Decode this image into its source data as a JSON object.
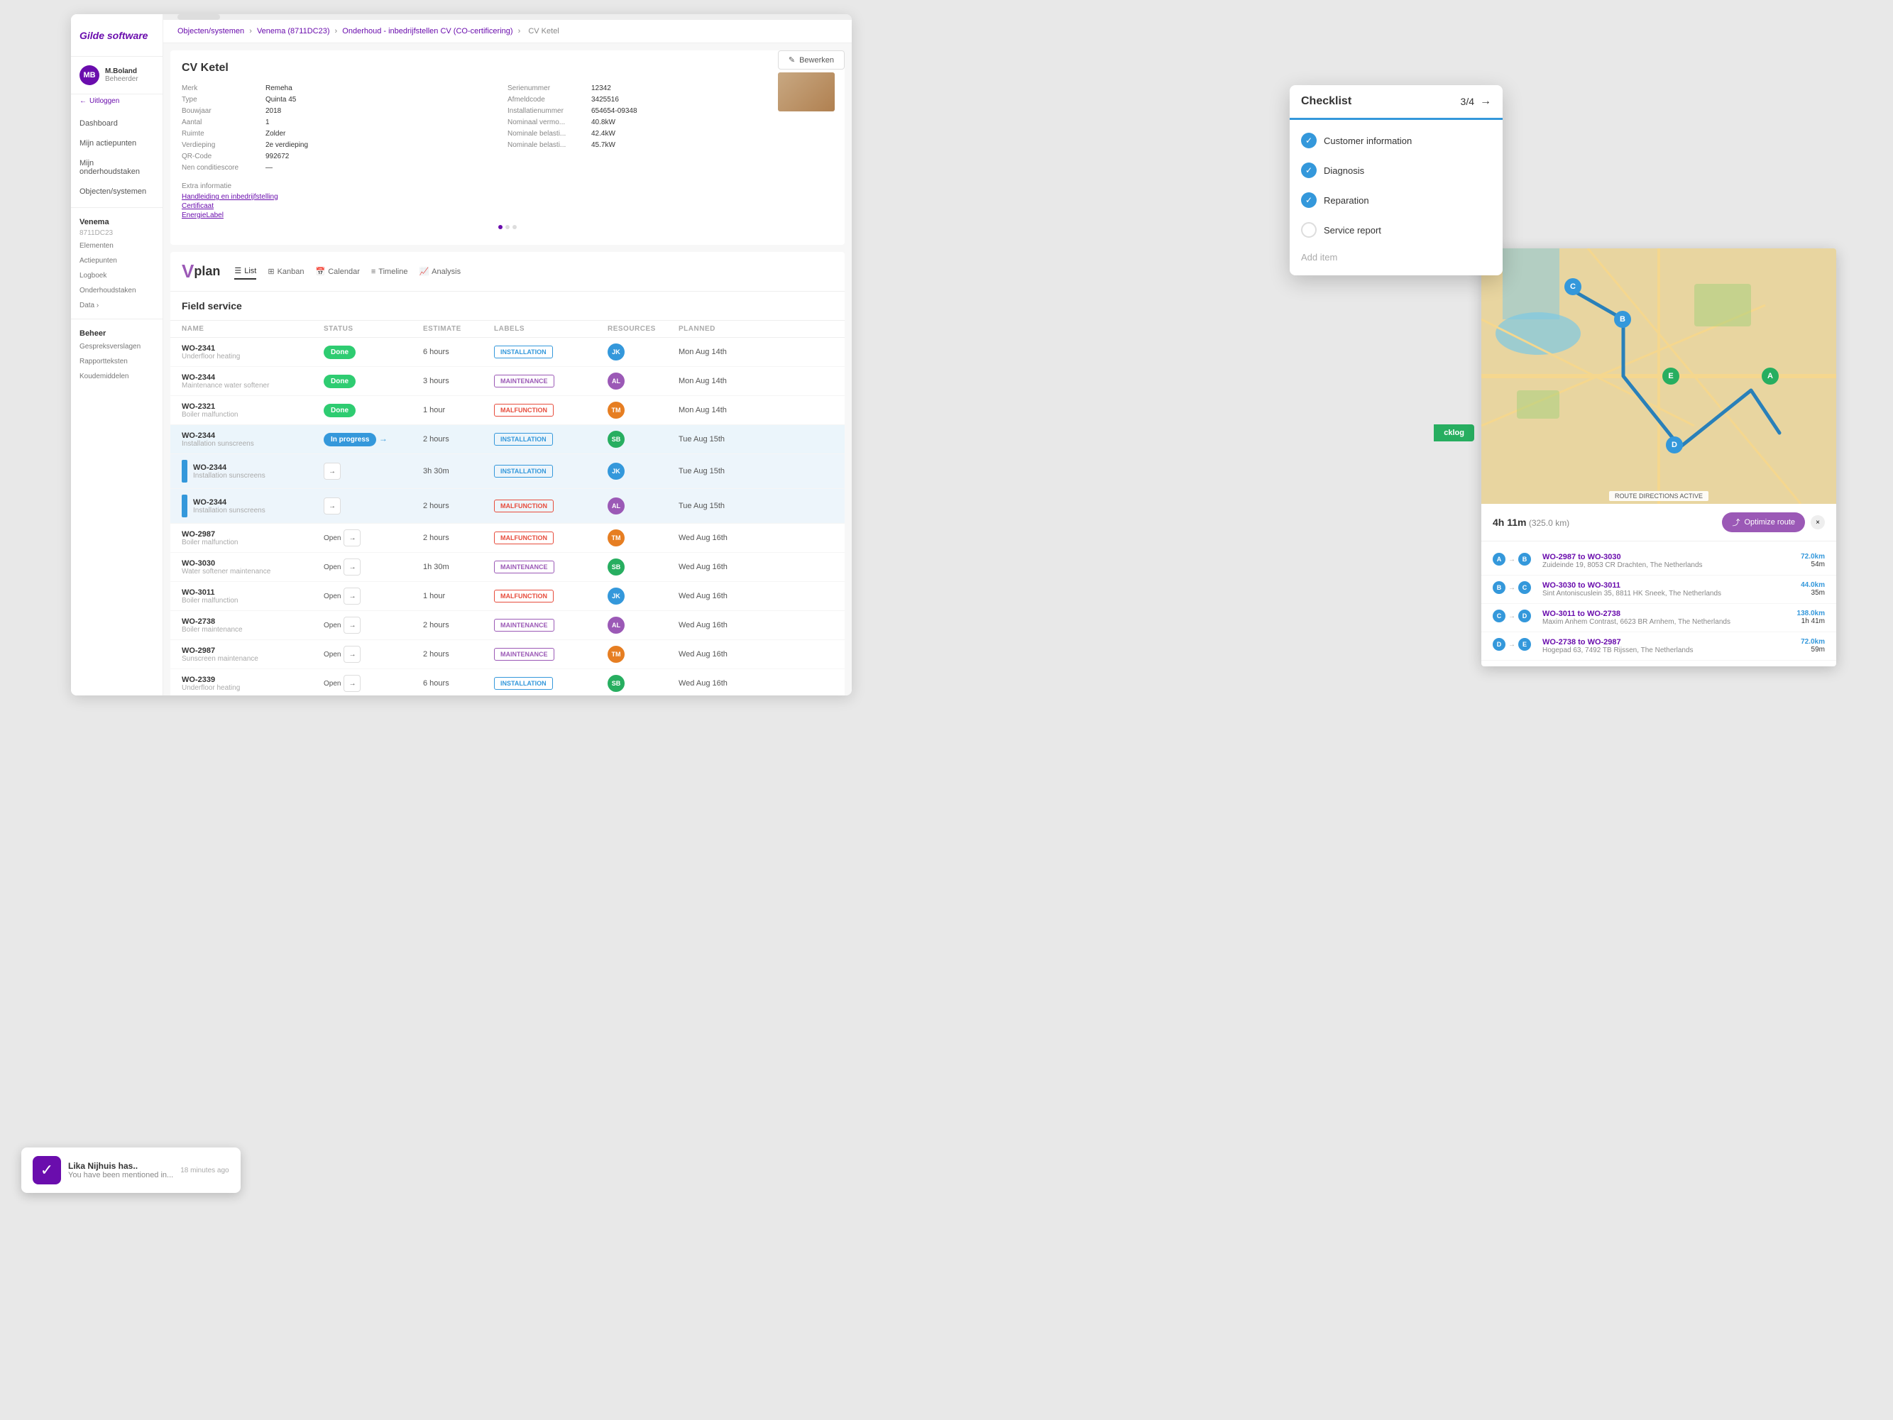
{
  "app": {
    "title": "Gilde software"
  },
  "sidebar": {
    "logo": "Gilde",
    "logo_sub": "software",
    "user": {
      "initials": "MB",
      "name": "M.Boland",
      "role": "Beheerder"
    },
    "logout_label": "Uitloggen",
    "nav_items": [
      {
        "label": "Dashboard",
        "active": false
      },
      {
        "label": "Mijn actiepunten",
        "active": false
      },
      {
        "label": "Mijn onderhoudstaken",
        "active": false
      },
      {
        "label": "Objecten/systemen",
        "active": false
      }
    ],
    "group_label": "Venema",
    "group_sub": "8711DC23",
    "group_items": [
      {
        "label": "Elementen"
      },
      {
        "label": "Actiepunten"
      },
      {
        "label": "Logboek"
      },
      {
        "label": "Onderhoudstaken"
      },
      {
        "label": "Data",
        "has_arrow": true
      }
    ],
    "beheer_label": "Beheer",
    "beheer_items": [
      {
        "label": "Gespreksverslagen"
      },
      {
        "label": "Rapportteksten"
      },
      {
        "label": "Koudemiddelen"
      }
    ]
  },
  "breadcrumb": {
    "items": [
      "Objecten/systemen",
      "Venema (8711DC23)",
      "Onderhoud - inbedrijfstellen CV (CO-certificering)",
      "CV Ketel"
    ],
    "separators": [
      ">",
      ">",
      ">"
    ]
  },
  "detail": {
    "title": "CV Ketel",
    "bewerken_label": "Bewerken",
    "fields_left": [
      {
        "label": "Merk",
        "value": "Remeha"
      },
      {
        "label": "Type",
        "value": "Quinta 45"
      },
      {
        "label": "Bouwjaar",
        "value": "2018"
      },
      {
        "label": "Aantal",
        "value": "1"
      },
      {
        "label": "Ruimte",
        "value": "Zolder"
      },
      {
        "label": "Verdieping",
        "value": "2e verdieping"
      },
      {
        "label": "QR-Code",
        "value": "992672"
      },
      {
        "label": "Nen conditiescore",
        "value": "—"
      }
    ],
    "fields_right": [
      {
        "label": "Serienummer",
        "value": "12342"
      },
      {
        "label": "Afmeldcode",
        "value": "3425516"
      },
      {
        "label": "Installatienummer",
        "value": "654654-09348"
      },
      {
        "label": "Nominaal vermo...",
        "value": "40.8kW"
      },
      {
        "label": "Nominale belasti...",
        "value": "42.4kW"
      },
      {
        "label": "Nominale belasti...",
        "value": "45.7kW"
      }
    ],
    "extra_info": "Extra informatie",
    "links": [
      "Handleiding en inbedrijfstelling",
      "Certificaat",
      "EnergieLabel"
    ],
    "dots": 3
  },
  "vplan": {
    "logo": "Vplan",
    "nav": [
      {
        "label": "List",
        "icon": "list",
        "active": true
      },
      {
        "label": "Kanban",
        "icon": "kanban",
        "active": false
      },
      {
        "label": "Calendar",
        "icon": "calendar",
        "active": false
      },
      {
        "label": "Timeline",
        "icon": "timeline",
        "active": false
      },
      {
        "label": "Analysis",
        "icon": "analysis",
        "active": false
      }
    ],
    "section_title": "Field service",
    "table_headers": [
      "NAME",
      "STATUS",
      "ESTIMATE",
      "LABELS",
      "RESOURCES",
      "PLANNED"
    ],
    "rows": [
      {
        "id": "WO-2341",
        "sub": "Underfloor heating",
        "status": "Done",
        "status_type": "done",
        "estimate": "6 hours",
        "label": "INSTALLATION",
        "label_type": "installation",
        "resource_color": "blue",
        "resource_initials": "JK",
        "planned": "Mon Aug 14th"
      },
      {
        "id": "WO-2344",
        "sub": "Maintenance water softener",
        "status": "Done",
        "status_type": "done",
        "estimate": "3 hours",
        "label": "MAINTENANCE",
        "label_type": "maintenance",
        "resource_color": "purple",
        "resource_initials": "AL",
        "planned": "Mon Aug 14th"
      },
      {
        "id": "WO-2321",
        "sub": "Boiler malfunction",
        "status": "Done",
        "status_type": "done",
        "estimate": "1 hour",
        "label": "MALFUNCTION",
        "label_type": "malfunction",
        "resource_color": "orange",
        "resource_initials": "TM",
        "planned": "Mon Aug 14th"
      },
      {
        "id": "WO-2344",
        "sub": "Installation sunscreens",
        "status": "In progress",
        "status_type": "in-progress",
        "estimate": "2 hours",
        "label": "INSTALLATION",
        "label_type": "installation",
        "resource_color": "green",
        "resource_initials": "SB",
        "planned": "Tue Aug 15th"
      },
      {
        "id": "WO-2344",
        "sub": "Installation sunscreens",
        "status": "",
        "status_type": "arrow-blue",
        "estimate": "3h 30m",
        "label": "INSTALLATION",
        "label_type": "installation",
        "resource_color": "blue",
        "resource_initials": "JK",
        "planned": "Tue Aug 15th"
      },
      {
        "id": "WO-2344",
        "sub": "Installation sunscreens",
        "status": "",
        "status_type": "arrow-blue",
        "estimate": "2 hours",
        "label": "MALFUNCTION",
        "label_type": "malfunction",
        "resource_color": "purple",
        "resource_initials": "AL",
        "planned": "Tue Aug 15th"
      },
      {
        "id": "WO-2987",
        "sub": "Boiler malfunction",
        "status": "Open",
        "status_type": "open",
        "estimate": "2 hours",
        "label": "MALFUNCTION",
        "label_type": "malfunction",
        "resource_color": "orange",
        "resource_initials": "TM",
        "planned": "Wed Aug 16th"
      },
      {
        "id": "WO-3030",
        "sub": "Water softener maintenance",
        "status": "Open",
        "status_type": "open",
        "estimate": "1h 30m",
        "label": "MAINTENANCE",
        "label_type": "maintenance",
        "resource_color": "green",
        "resource_initials": "SB",
        "planned": "Wed Aug 16th"
      },
      {
        "id": "WO-3011",
        "sub": "Boiler malfunction",
        "status": "Open",
        "status_type": "open",
        "estimate": "1 hour",
        "label": "MALFUNCTION",
        "label_type": "malfunction",
        "resource_color": "blue",
        "resource_initials": "JK",
        "planned": "Wed Aug 16th"
      },
      {
        "id": "WO-2738",
        "sub": "Boiler maintenance",
        "status": "Open",
        "status_type": "open",
        "estimate": "2 hours",
        "label": "MAINTENANCE",
        "label_type": "maintenance",
        "resource_color": "purple",
        "resource_initials": "AL",
        "planned": "Wed Aug 16th"
      },
      {
        "id": "WO-2987",
        "sub": "Sunscreen maintenance",
        "status": "Open",
        "status_type": "open",
        "estimate": "2 hours",
        "label": "MAINTENANCE",
        "label_type": "maintenance",
        "resource_color": "orange",
        "resource_initials": "TM",
        "planned": "Wed Aug 16th"
      },
      {
        "id": "WO-2339",
        "sub": "Underfloor heating",
        "status": "Open",
        "status_type": "open",
        "estimate": "6 hours",
        "label": "INSTALLATION",
        "label_type": "installation",
        "resource_color": "green",
        "resource_initials": "SB",
        "planned": "Wed Aug 16th"
      }
    ]
  },
  "checklist": {
    "title": "Checklist",
    "progress": "3/4",
    "items": [
      {
        "label": "Customer information",
        "checked": true
      },
      {
        "label": "Diagnosis",
        "checked": true
      },
      {
        "label": "Reparation",
        "checked": true
      },
      {
        "label": "Service report",
        "checked": false
      }
    ],
    "add_item_label": "Add item"
  },
  "map": {
    "label": "ROUTE DIRECTIONS ACTIVE",
    "route_time": "4h 11m",
    "route_dist": "(325.0 km)",
    "optimize_btn": "Optimize route",
    "close": "×",
    "markers": [
      "A",
      "B",
      "C",
      "D",
      "E"
    ],
    "legs": [
      {
        "from": "A",
        "to": "B",
        "wo": "WO-2987 to WO-3030",
        "address": "Zuideinde 19, 8053 CR Drachten, The Netherlands",
        "km": "72.0km",
        "time": "54m"
      },
      {
        "from": "B",
        "to": "C",
        "wo": "WO-3030 to WO-3011",
        "address": "Sint Antoniscuslein 35, 8811 HK Sneek, The Netherlands",
        "km": "44.0km",
        "time": "35m"
      },
      {
        "from": "C",
        "to": "D",
        "wo": "WO-3011 to WO-2738",
        "address": "Maxim Anhem Contrast, 6623 BR Arnhem, The Netherlands",
        "km": "138.0km",
        "time": "1h 41m"
      },
      {
        "from": "D",
        "to": "E",
        "wo": "WO-2738 to WO-2987",
        "address": "Hogepad 63, 7492 TB Rijssen, The Netherlands",
        "km": "72.0km",
        "time": "59m"
      }
    ]
  },
  "notification": {
    "user": "Lika Nijhuis has..",
    "message": "You have been mentioned in...",
    "time": "18 minutes ago"
  },
  "backlog": {
    "label": "cklog"
  }
}
